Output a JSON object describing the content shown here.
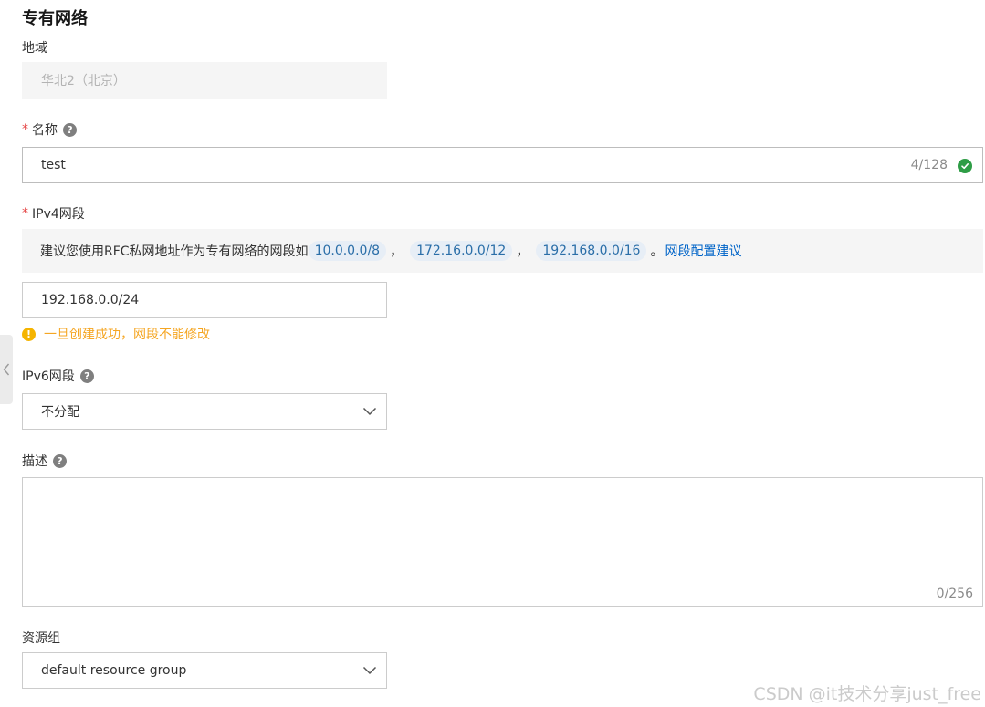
{
  "section_title": "专有网络",
  "region": {
    "label": "地域",
    "value": "华北2（北京）"
  },
  "name": {
    "required_mark": "*",
    "label": "名称",
    "value": "test",
    "counter": "4/128"
  },
  "ipv4": {
    "required_mark": "*",
    "label": "IPv4网段",
    "hint_text": "建议您使用RFC私网地址作为专有网络的网段如",
    "cidr_options": [
      "10.0.0.0/8",
      "172.16.0.0/12",
      "192.168.0.0/16"
    ],
    "separator": "，",
    "end_mark": "。",
    "hint_link": "网段配置建议",
    "value": "192.168.0.0/24",
    "warning": "一旦创建成功，网段不能修改"
  },
  "ipv6": {
    "label": "IPv6网段",
    "selected": "不分配"
  },
  "description": {
    "label": "描述",
    "value": "",
    "counter": "0/256"
  },
  "resource_group": {
    "label": "资源组",
    "selected": "default resource group"
  },
  "watermark": "CSDN @it技术分享just_free",
  "colors": {
    "required": "#e54545",
    "link": "#0064c8",
    "tag_bg": "#e7eef6",
    "warning": "#f5a623",
    "success": "#2e9d46"
  }
}
